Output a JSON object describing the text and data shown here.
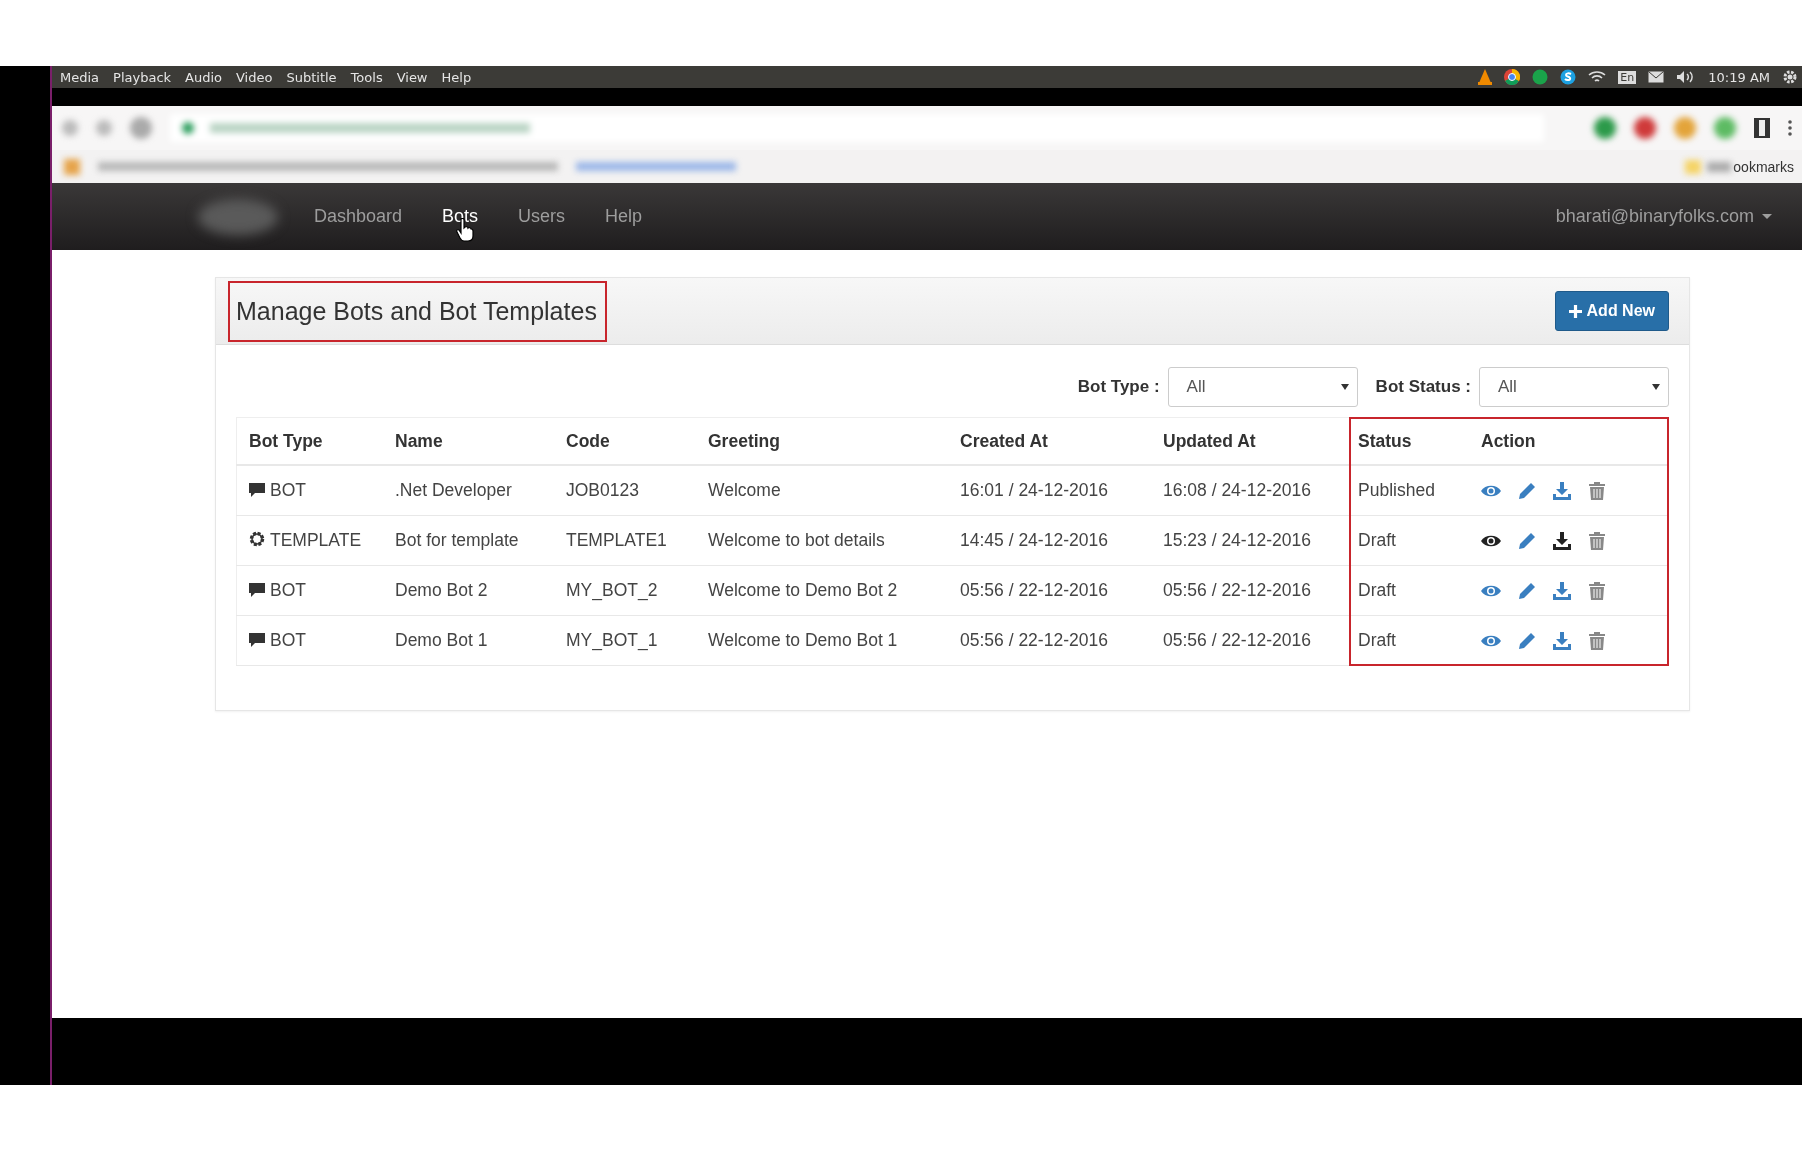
{
  "player_menu": [
    "Media",
    "Playback",
    "Audio",
    "Video",
    "Subtitle",
    "Tools",
    "View",
    "Help"
  ],
  "tray": {
    "keyboard": "En",
    "time": "10:19 AM"
  },
  "browser": {
    "bookmarks_label": "ookmarks"
  },
  "nav": {
    "items": [
      {
        "label": "Dashboard",
        "selected": false
      },
      {
        "label": "Bots",
        "selected": true
      },
      {
        "label": "Users",
        "selected": false
      },
      {
        "label": "Help",
        "selected": false
      }
    ],
    "user": "bharati@binaryfolks.com"
  },
  "page": {
    "title": "Manage Bots and Bot Templates",
    "add_button": "Add New",
    "filters": [
      {
        "label": "Bot Type :",
        "value": "All"
      },
      {
        "label": "Bot Status :",
        "value": "All"
      }
    ]
  },
  "table": {
    "columns": [
      "Bot Type",
      "Name",
      "Code",
      "Greeting",
      "Created At",
      "Updated At",
      "Status",
      "Action"
    ],
    "rows": [
      {
        "kind": "bot",
        "bot_type": "BOT",
        "name": ".Net Developer",
        "code": "JOB0123",
        "greeting": "Welcome",
        "created_at": "16:01 / 24-12-2016",
        "updated_at": "16:08 / 24-12-2016",
        "status": "Published",
        "hovered": false
      },
      {
        "kind": "template",
        "bot_type": "TEMPLATE",
        "name": "Bot for template",
        "code": "TEMPLATE1",
        "greeting": "Welcome to bot details",
        "created_at": "14:45 / 24-12-2016",
        "updated_at": "15:23 / 24-12-2016",
        "status": "Draft",
        "hovered": true
      },
      {
        "kind": "bot",
        "bot_type": "BOT",
        "name": "Demo Bot 2",
        "code": "MY_BOT_2",
        "greeting": "Welcome to Demo Bot 2",
        "created_at": "05:56 / 22-12-2016",
        "updated_at": "05:56 / 22-12-2016",
        "status": "Draft",
        "hovered": false
      },
      {
        "kind": "bot",
        "bot_type": "BOT",
        "name": "Demo Bot 1",
        "code": "MY_BOT_1",
        "greeting": "Welcome to Demo Bot 1",
        "created_at": "05:56 / 22-12-2016",
        "updated_at": "05:56 / 22-12-2016",
        "status": "Draft",
        "hovered": false
      }
    ]
  }
}
